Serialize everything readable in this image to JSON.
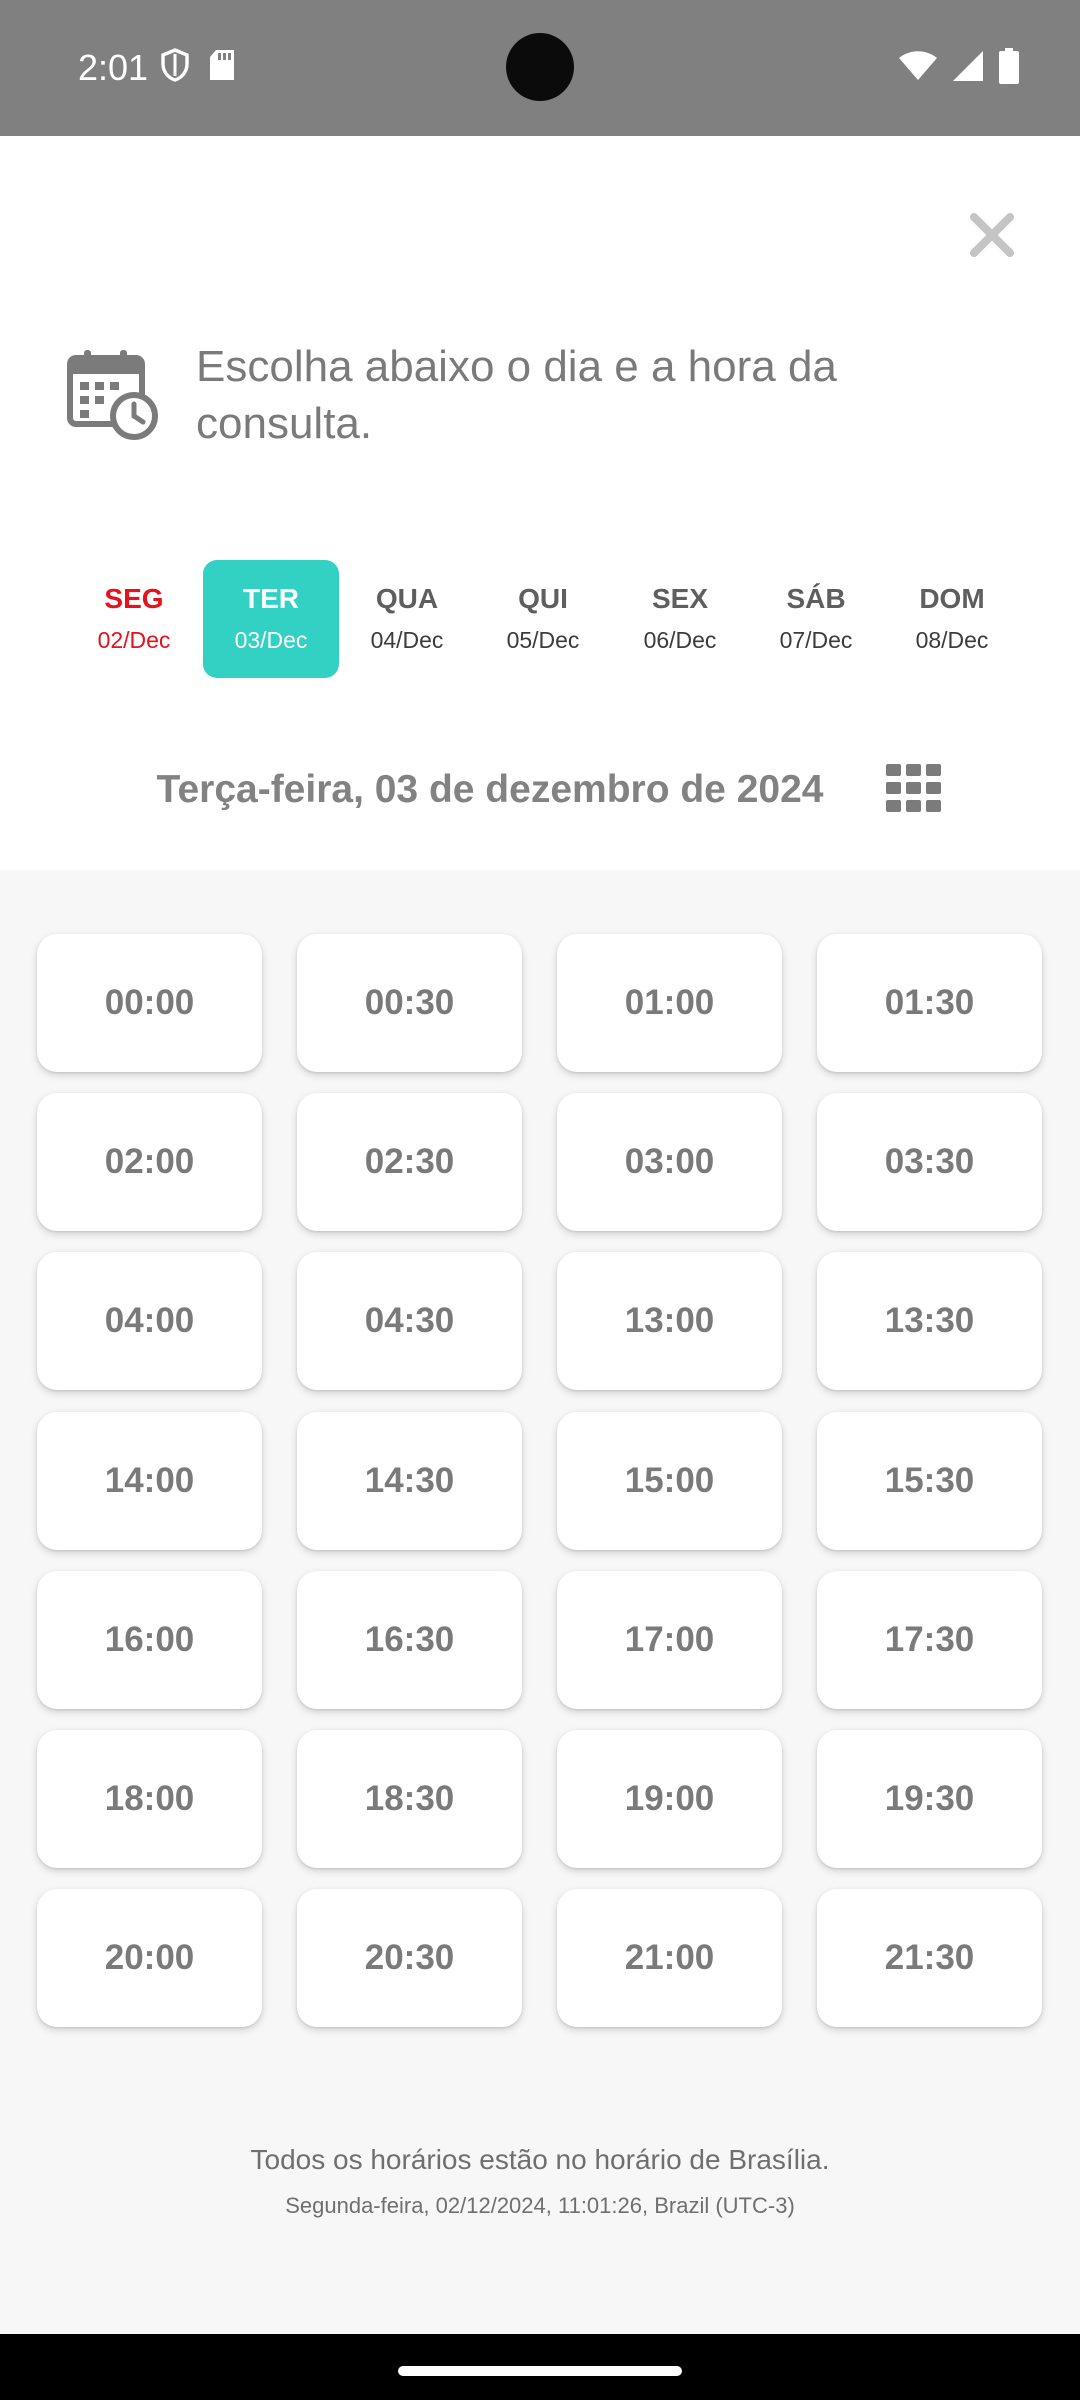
{
  "status_bar": {
    "time": "2:01",
    "icons": [
      "shield-icon",
      "sd-card-icon",
      "wifi-icon",
      "signal-icon",
      "battery-icon"
    ]
  },
  "header": {
    "close_icon": "close-icon",
    "calendar_icon": "calendar-clock-icon",
    "instruction": "Escolha abaixo o dia e a hora da consulta."
  },
  "days": [
    {
      "name": "SEG",
      "date": "02/Dec"
    },
    {
      "name": "TER",
      "date": "03/Dec"
    },
    {
      "name": "QUA",
      "date": "04/Dec"
    },
    {
      "name": "QUI",
      "date": "05/Dec"
    },
    {
      "name": "SEX",
      "date": "06/Dec"
    },
    {
      "name": "SÁB",
      "date": "07/Dec"
    },
    {
      "name": "DOM",
      "date": "08/Dec"
    }
  ],
  "today_day": "SEG",
  "selected_day": "TER",
  "selected_date_label": "Terça-feira, 03 de dezembro de 2024",
  "grid_icon": "grid-view-icon",
  "time_slots": [
    "00:00",
    "00:30",
    "01:00",
    "01:30",
    "02:00",
    "02:30",
    "03:00",
    "03:30",
    "04:00",
    "04:30",
    "13:00",
    "13:30",
    "14:00",
    "14:30",
    "15:00",
    "15:30",
    "16:00",
    "16:30",
    "17:00",
    "17:30",
    "18:00",
    "18:30",
    "19:00",
    "19:30",
    "20:00",
    "20:30",
    "21:00",
    "21:30"
  ],
  "footer": {
    "timezone_note": "Todos os horários estão no horário de Brasília.",
    "current_time": "Segunda-feira, 02/12/2024, 11:01:26, Brazil (UTC-3)"
  },
  "colors": {
    "accent": "#33d1c3",
    "today": "#e8101a",
    "status_bar": "#808080",
    "panel_background": "#f7f7f7"
  }
}
